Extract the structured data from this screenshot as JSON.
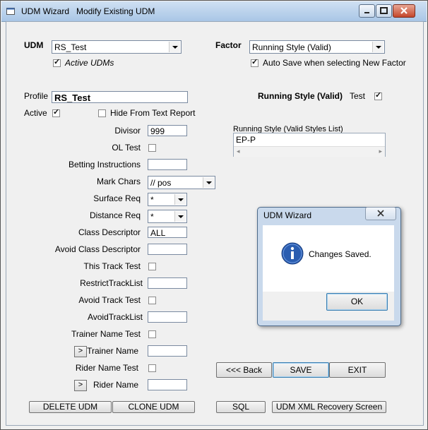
{
  "window": {
    "title_prefix": "UDM Wizard",
    "title_suffix": "Modify Existing UDM",
    "controls": [
      "minimize",
      "maximize",
      "close"
    ]
  },
  "udm": {
    "label": "UDM",
    "value": "RS_Test",
    "active_udms_label": "Active UDMs",
    "active_udms_checked": true
  },
  "factor": {
    "label": "Factor",
    "value": "Running Style (Valid)",
    "auto_save_label": "Auto Save when selecting New Factor",
    "auto_save_checked": true
  },
  "profile": {
    "label": "Profile",
    "value": "RS_Test"
  },
  "active": {
    "label": "Active",
    "checked": true
  },
  "hide_from_text": {
    "label": "Hide From Text Report",
    "checked": false
  },
  "factor_heading": {
    "label": "Running Style (Valid)",
    "test_label": "Test",
    "test_checked": true
  },
  "styles_list": {
    "label": "Running Style (Valid Styles List)",
    "items": [
      "EP-P"
    ]
  },
  "form": {
    "divisor_label": "Divisor",
    "divisor_value": "999",
    "ol_test_label": "OL Test",
    "betting_instructions_label": "Betting Instructions",
    "betting_instructions_value": "",
    "mark_chars_label": "Mark Chars",
    "mark_chars_value": "// pos",
    "surface_req_label": "Surface Req",
    "surface_req_value": "*",
    "distance_req_label": "Distance Req",
    "distance_req_value": "*",
    "class_descriptor_label": "Class Descriptor",
    "class_descriptor_value": "ALL",
    "avoid_class_descriptor_label": "Avoid Class Descriptor",
    "avoid_class_descriptor_value": "",
    "this_track_test_label": "This Track Test",
    "restrict_track_list_label": "RestrictTrackList",
    "restrict_track_list_value": "",
    "avoid_track_test_label": "Avoid Track Test",
    "avoid_track_list_label": "AvoidTrackList",
    "avoid_track_list_value": "",
    "trainer_name_test_label": "Trainer Name Test",
    "trainer_name_label": "Trainer Name",
    "trainer_name_value": "",
    "rider_name_test_label": "Rider Name Test",
    "rider_name_label": "Rider Name",
    "rider_name_value": "",
    "expand_glyph": ">"
  },
  "buttons": {
    "back": "<<< Back",
    "save": "SAVE",
    "exit": "EXIT",
    "delete": "DELETE UDM",
    "clone": "CLONE UDM",
    "sql": "SQL",
    "xml_recovery": "UDM XML Recovery Screen"
  },
  "dialog": {
    "title": "UDM Wizard",
    "message": "Changes Saved.",
    "ok": "OK",
    "icon": "info-icon",
    "icon_color": "#2a5db0"
  }
}
